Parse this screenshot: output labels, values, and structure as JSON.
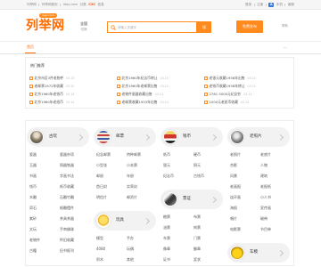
{
  "colors": {
    "accent": "#ff6a00",
    "accent_light": "#ff8a1e",
    "badge_blue": "#3a78d8"
  },
  "topbar": {
    "site": "列举网",
    "home": "列举网首页",
    "domain": "lieju.com",
    "category": "分类",
    "highlight": "C2C",
    "tail": "信息",
    "login": "登录",
    "register": "注册",
    "app_badge": "A",
    "app": "手机",
    "service": "客服"
  },
  "header": {
    "logo": "列举网",
    "logo_domain": "lieju.com",
    "city": "全国",
    "city_switch": "切换",
    "search_placeholder": "请输入关键字",
    "search_button": "搜",
    "publish": "免费发布",
    "help": "帮助"
  },
  "nav": {
    "home": "首页",
    "more": "···"
  },
  "hot": {
    "title": "热门推荐",
    "columns": [
      [
        {
          "title": "北京市区3件老物件",
          "date": "03-15"
        },
        {
          "title": "老邮票1972年收藏",
          "date": "03-15"
        },
        {
          "title": "北京1960年老钱币",
          "date": "03-14"
        },
        {
          "title": "北京1960年老纸币",
          "date": "03-14"
        }
      ],
      [
        {
          "title": "北京1960年纪念币转让",
          "date": "03-15"
        },
        {
          "title": "北京1960年老邮票出售",
          "date": "03-15"
        },
        {
          "title": "老物件瓷器收藏出售",
          "date": "03-14"
        },
        {
          "title": "老邮票收藏1953年出售",
          "date": "03-14"
        }
      ],
      [
        {
          "title": "老银元收藏1958年出售",
          "date": "03-15"
        },
        {
          "title": "老钱币收藏1958年转让",
          "date": "03-15"
        },
        {
          "title": "2781 5000元纪念钞",
          "date": "03-14"
        },
        {
          "title": "1000元老纸币收藏",
          "date": "03-14"
        }
      ]
    ]
  },
  "categories": {
    "columns": [
      {
        "groups": [
          {
            "title": "古玩",
            "icon": "antique-photo",
            "rows": [
              [
                "瓷器",
                "瓷器杂项"
              ],
              [
                "玉器",
                "铜器铁器"
              ],
              [
                "书画",
                "字画书法"
              ],
              [
                "钱币",
                "纸币收藏"
              ],
              [
                "木雕",
                "石雕竹雕"
              ],
              [
                "奇石",
                "根雕摆件"
              ],
              [
                "紫砂",
                "茶具茶器"
              ],
              [
                "文玩",
                "手串佛珠"
              ],
              [
                "老物件",
                "怀旧收藏"
              ],
              [
                "古籍",
                "旧书报刊"
              ]
            ]
          }
        ]
      },
      {
        "groups": [
          {
            "title": "邮票",
            "icon": "stamp",
            "rows": [
              [
                "纪念邮票",
                "特种邮票"
              ],
              [
                "小型张",
                "小本票"
              ],
              [
                "邮册",
                "年册"
              ],
              [
                "首日封",
                "实寄封"
              ],
              [
                "明信片",
                "邮资片"
              ]
            ]
          },
          {
            "title": "玩具",
            "icon": "toy-figure",
            "rows": [
              [
                "模型",
                "手办"
              ],
              [
                "4080",
                "玩偶"
              ],
              [
                "积木",
                "其他"
              ]
            ]
          }
        ]
      },
      {
        "groups": [
          {
            "title": "钱币",
            "icon": "flag",
            "rows": [
              [
                "纸币",
                "硬币"
              ],
              [
                "银元",
                "铜元"
              ],
              [
                "纪念币",
                "古钱币"
              ]
            ]
          },
          {
            "title": "票证",
            "icon": "bw-photo",
            "rows": [
              [
                "粮票",
                "布票"
              ],
              [
                "油票",
                "肉票"
              ],
              [
                "车票",
                "门票"
              ],
              [
                "像章",
                "徽章"
              ],
              [
                "证书",
                "奖状"
              ]
            ]
          }
        ]
      },
      {
        "groups": [
          {
            "title": "老照片",
            "icon": "old-photo",
            "rows": [
              [
                "老照片",
                "老底片"
              ],
              [
                "合影",
                "人物"
              ],
              [
                "风景",
                "建筑"
              ],
              [
                "老画报",
                "老报纸"
              ],
              [
                "连环画",
                "小人书"
              ],
              [
                "海报",
                "宣传画"
              ],
              [
                "唱片",
                "磁带"
              ],
              [
                "电影票",
                "节目单"
              ]
            ]
          },
          {
            "title": "车模",
            "icon": "toy-car",
            "rows": []
          }
        ]
      }
    ]
  }
}
